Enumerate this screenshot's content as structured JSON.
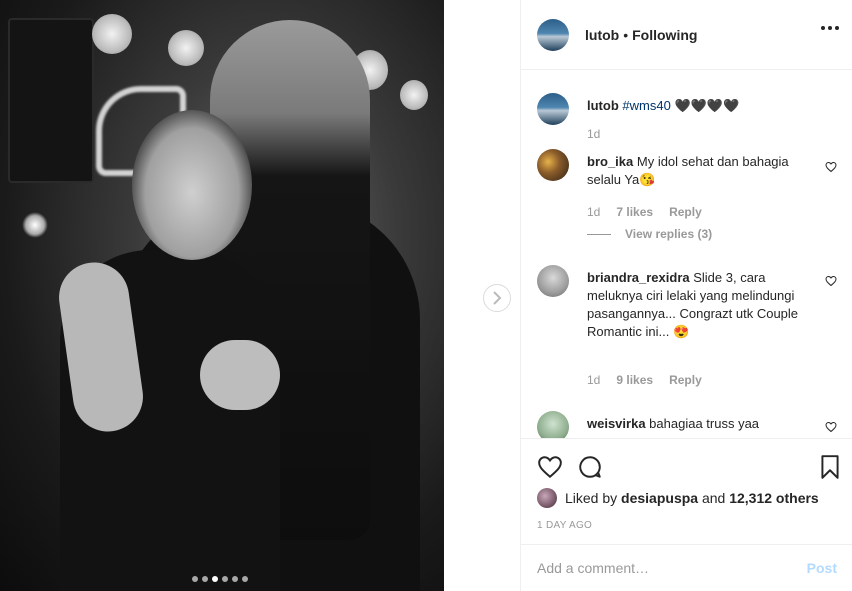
{
  "header": {
    "username": "lutob",
    "separator": "•",
    "follow_status": "Following"
  },
  "caption": {
    "username": "lutob",
    "hashtag": "#wms40",
    "emoji": "🖤🖤🖤🖤",
    "time": "1d"
  },
  "comments": [
    {
      "username": "bro_ika",
      "text": "My idol sehat dan bahagia selalu Ya😘",
      "time": "1d",
      "likes": "7 likes",
      "reply": "Reply",
      "view_replies": "View replies (3)"
    },
    {
      "username": "briandra_rexidra",
      "text": "Slide 3, cara meluknya ciri lelaki yang melindungi pasangannya... Congrazt utk Couple Romantic ini... 😍",
      "time": "1d",
      "likes": "9 likes",
      "reply": "Reply"
    },
    {
      "username": "weisvirka",
      "text": "bahagiaa truss yaa"
    }
  ],
  "likes": {
    "prefix": "Liked by",
    "user": "desiapuspa",
    "middle": "and",
    "count": "12,312 others"
  },
  "timestamp": "1 DAY AGO",
  "add_comment": {
    "placeholder": "Add a comment…",
    "post_label": "Post"
  },
  "carousel": {
    "slide_count": 6,
    "active_index": 2
  },
  "colors": {
    "link": "#003569",
    "muted": "#999999",
    "post_disabled": "#b3dbff"
  }
}
